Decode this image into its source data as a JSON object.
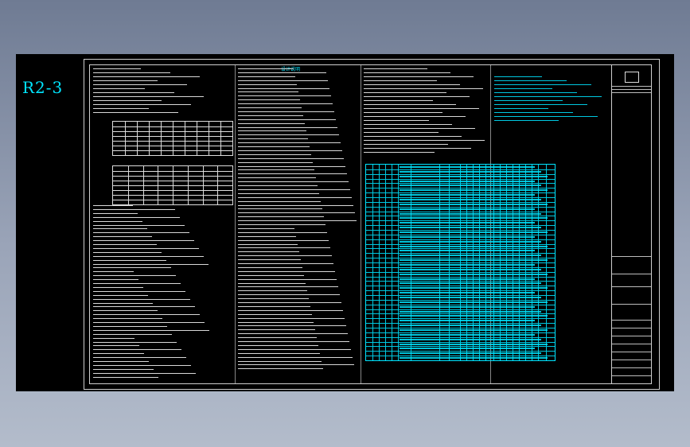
{
  "drawing": {
    "sheet_label": "R2-3",
    "center_title": "设计说明"
  },
  "colors": {
    "background": "#000000",
    "accent_cyan": "#00e5ff",
    "line_white": "#cfcfcf"
  }
}
